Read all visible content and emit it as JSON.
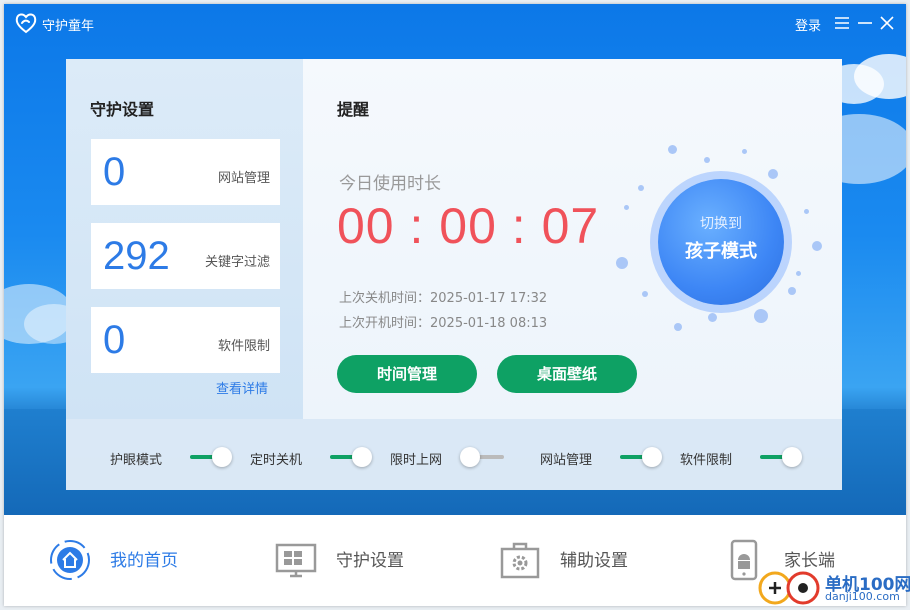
{
  "titlebar": {
    "app_name": "守护童年",
    "login_label": "登录"
  },
  "guard_settings": {
    "title": "守护设置",
    "stats": [
      {
        "value": "0",
        "label": "网站管理"
      },
      {
        "value": "292",
        "label": "关键字过滤"
      },
      {
        "value": "0",
        "label": "软件限制"
      }
    ],
    "details_link": "查看详情"
  },
  "reminder": {
    "title": "提醒",
    "usage_label": "今日使用时长",
    "timer": "00 : 00 : 07",
    "last_shutdown": "上次关机时间：2025-01-17  17:32",
    "last_boot": "上次开机时间：2025-01-18  08:13",
    "buttons": {
      "time_management": "时间管理",
      "desktop_wallpaper": "桌面壁纸"
    }
  },
  "mode_switch": {
    "sub": "切换到",
    "main": "孩子模式"
  },
  "toggles": [
    {
      "label": "护眼模式",
      "on": true
    },
    {
      "label": "定时关机",
      "on": true
    },
    {
      "label": "限时上网",
      "on": false
    },
    {
      "label": "网站管理",
      "on": true
    },
    {
      "label": "软件限制",
      "on": true
    }
  ],
  "nav": [
    {
      "label": "我的首页",
      "icon": "home-icon",
      "active": true
    },
    {
      "label": "守护设置",
      "icon": "monitor-grid-icon",
      "active": false
    },
    {
      "label": "辅助设置",
      "icon": "toolbox-gear-icon",
      "active": false
    },
    {
      "label": "家长端",
      "icon": "android-phone-icon",
      "active": false
    }
  ],
  "watermark": {
    "text": "单机100网",
    "url": "danji100.com"
  },
  "colors": {
    "brand_blue": "#0c78e8",
    "accent_green": "#0ea164",
    "timer_red": "#f0525a",
    "link_blue": "#2d7be6"
  }
}
